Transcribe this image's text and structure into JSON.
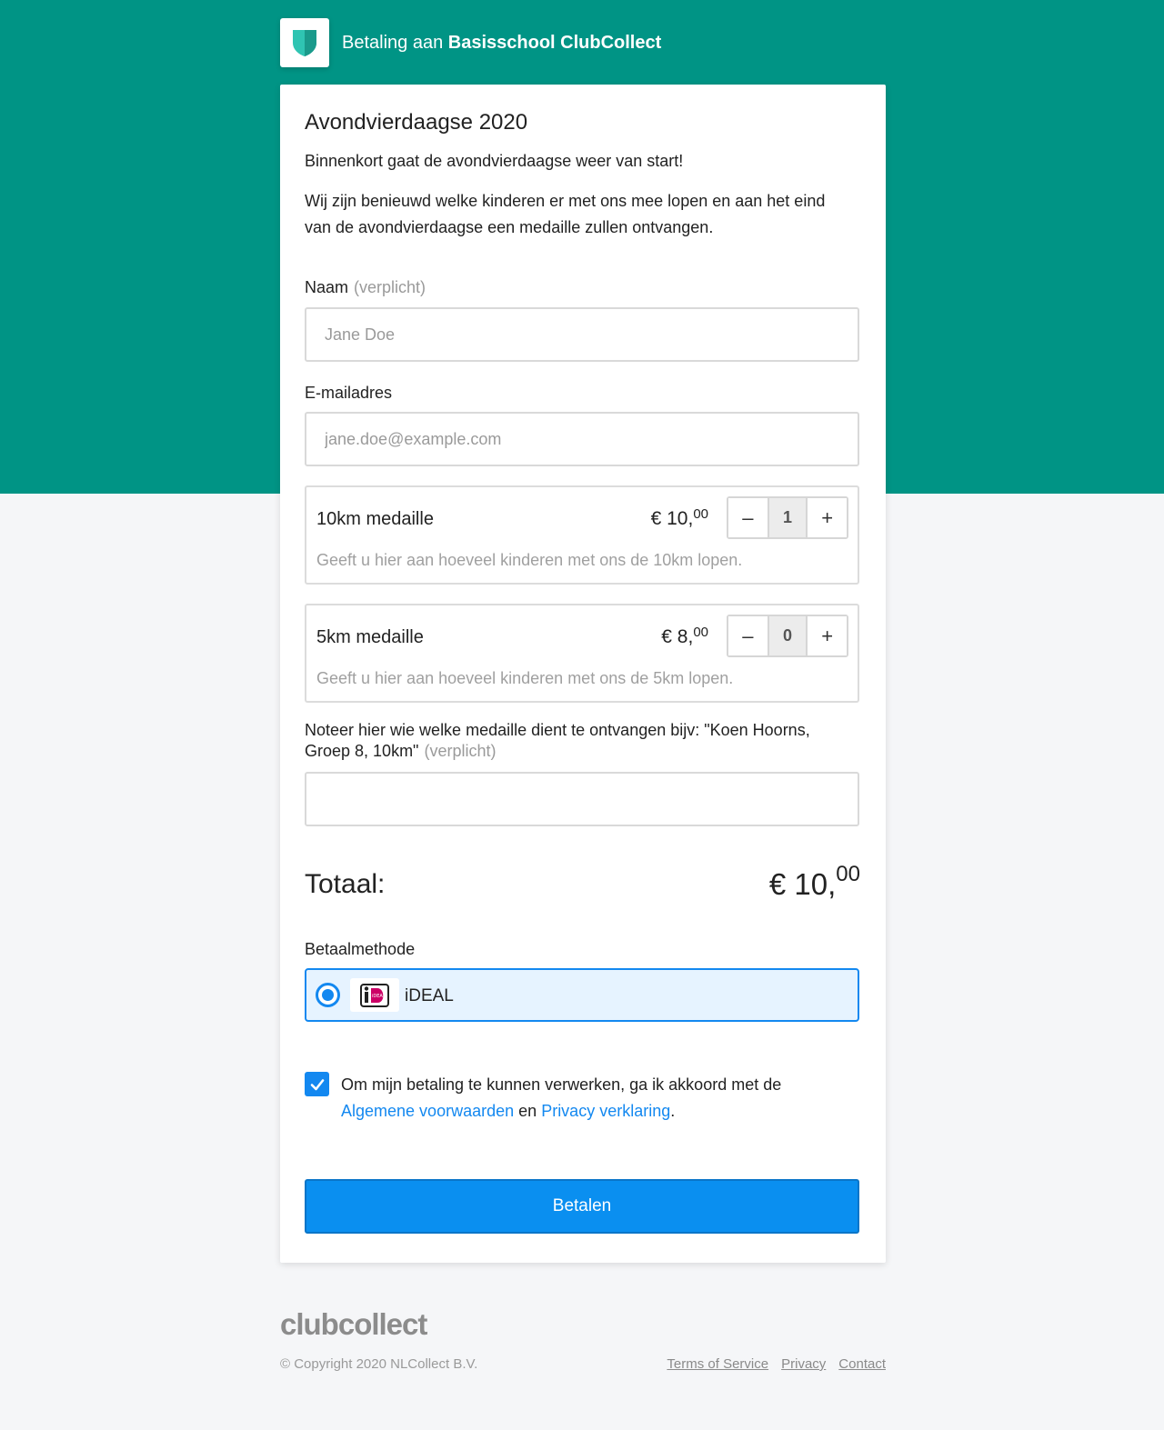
{
  "header": {
    "prefix": "Betaling aan",
    "organization": "Basisschool ClubCollect"
  },
  "form": {
    "title": "Avondvierdaagse 2020",
    "intro": "Binnenkort gaat de avondvierdaagse weer van start!",
    "description": "Wij zijn benieuwd welke kinderen er met ons mee lopen en aan het eind van de avondvierdaagse een medaille zullen ontvangen.",
    "name_label": "Naam",
    "required_label": "(verplicht)",
    "name_placeholder": "Jane Doe",
    "email_label": "E-mailadres",
    "email_placeholder": "jane.doe@example.com",
    "note_label": "Noteer hier wie welke medaille dient te ontvangen bijv: \"Koen Hoorns, Groep 8, 10km\"",
    "note_value": ""
  },
  "products": [
    {
      "name": "10km medaille",
      "price_main": "€ 10,",
      "price_cents": "00",
      "quantity": "1",
      "description": "Geeft u hier aan hoeveel kinderen met ons de 10km lopen."
    },
    {
      "name": "5km medaille",
      "price_main": "€ 8,",
      "price_cents": "00",
      "quantity": "0",
      "description": "Geeft u hier aan hoeveel kinderen met ons de 5km lopen."
    }
  ],
  "stepper": {
    "minus": "–",
    "plus": "+"
  },
  "total": {
    "label": "Totaal:",
    "main": "€ 10,",
    "cents": "00"
  },
  "payment": {
    "label": "Betaalmethode",
    "method": "iDEAL",
    "logo_text": "iDEAL"
  },
  "consent": {
    "text": "Om mijn betaling te kunnen verwerken, ga ik akkoord met de",
    "terms_link": "Algemene voorwaarden",
    "and": "en",
    "privacy_link": "Privacy verklaring",
    "end": "."
  },
  "pay_button": "Betalen",
  "footer": {
    "brand": "clubcollect",
    "copyright": "© Copyright 2020 NLCollect B.V.",
    "links": [
      "Terms of Service",
      "Privacy",
      "Contact"
    ]
  },
  "colors": {
    "brand_green": "#009485",
    "accent_blue": "#1388f0"
  }
}
